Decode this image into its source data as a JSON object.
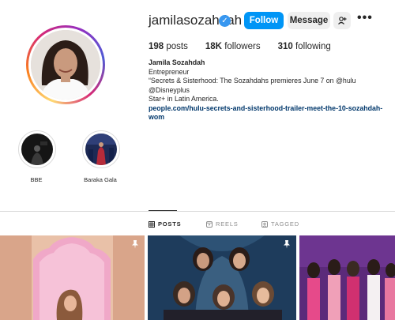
{
  "profile": {
    "username": "jamilasozahdah",
    "follow_label": "Follow",
    "message_label": "Message",
    "add_user_icon": "add-user-icon",
    "more_icon": "more-options-icon",
    "stats": {
      "posts_count": "198",
      "posts_label": "posts",
      "followers_count": "18K",
      "followers_label": "followers",
      "following_count": "310",
      "following_label": "following"
    },
    "bio": {
      "full_name": "Jamila Sozahdah",
      "category": "Entrepreneur",
      "line1": "“Secrets & Sisterhood: The Sozahdahs premieres June 7 on @hulu @Disneyplus",
      "line2": "Star+ in Latin America.",
      "link": "people.com/hulu-secrets-and-sisterhood-trailer-meet-the-10-sozahdah-wom"
    }
  },
  "highlights": [
    {
      "label": "BBE"
    },
    {
      "label": "Baraka Gala"
    }
  ],
  "tabs": [
    {
      "label": "POSTS",
      "icon": "grid-icon",
      "active": true
    },
    {
      "label": "REELS",
      "icon": "reels-icon",
      "active": false
    },
    {
      "label": "TAGGED",
      "icon": "tagged-icon",
      "active": false
    }
  ],
  "colors": {
    "accent": "#0095f6",
    "verified": "#3897f0",
    "link": "#00376b"
  }
}
